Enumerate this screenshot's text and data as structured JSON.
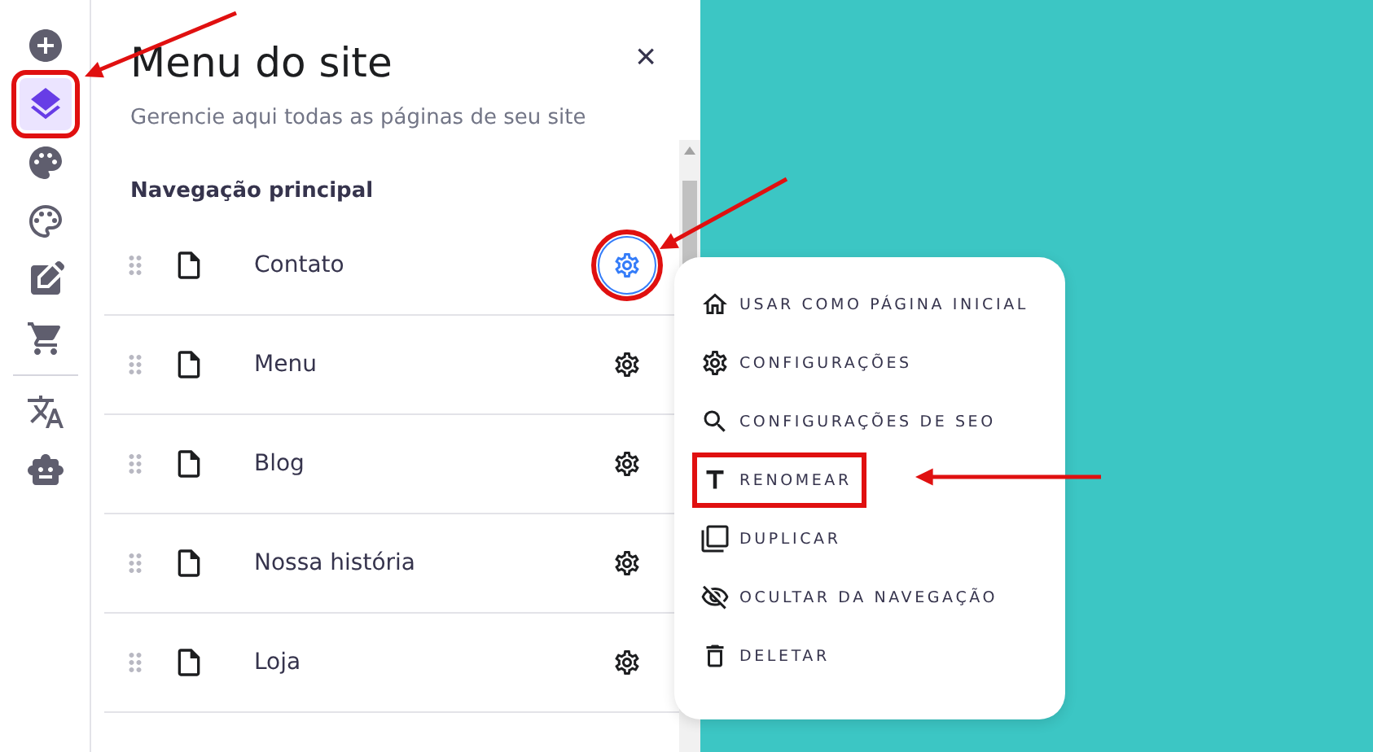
{
  "rail": {
    "top_items": [
      {
        "selected": false,
        "annotated": false
      },
      {
        "selected": true,
        "annotated": true
      },
      {
        "selected": false,
        "annotated": false
      },
      {
        "selected": false,
        "annotated": false
      },
      {
        "selected": false,
        "annotated": false
      },
      {
        "selected": false,
        "annotated": false
      }
    ],
    "bottom_items": [
      {
        "selected": false,
        "annotated": false
      },
      {
        "selected": false,
        "annotated": false
      }
    ]
  },
  "panel": {
    "title": "Menu do site",
    "close": "×",
    "subtitle": "Gerencie aqui todas as páginas de seu site",
    "section": "Navegação principal",
    "pages": [
      {
        "name": "Contato",
        "active": true,
        "annotated": true
      },
      {
        "name": "Menu",
        "active": false,
        "annotated": false
      },
      {
        "name": "Blog",
        "active": false,
        "annotated": false
      },
      {
        "name": "Nossa história",
        "active": false,
        "annotated": false
      },
      {
        "name": "Loja",
        "active": false,
        "annotated": false
      }
    ]
  },
  "context_menu": {
    "items": [
      {
        "label": "USAR COMO PÁGINA INICIAL",
        "annotated": false
      },
      {
        "label": "CONFIGURAÇÕES",
        "annotated": false
      },
      {
        "label": "CONFIGURAÇÕES DE SEO",
        "annotated": false
      },
      {
        "label": "RENOMEAR",
        "annotated": true
      },
      {
        "label": "DUPLICAR",
        "annotated": false
      },
      {
        "label": "OCULTAR DA NAVEGAÇÃO",
        "annotated": false
      },
      {
        "label": "DELETAR",
        "annotated": false
      }
    ]
  }
}
